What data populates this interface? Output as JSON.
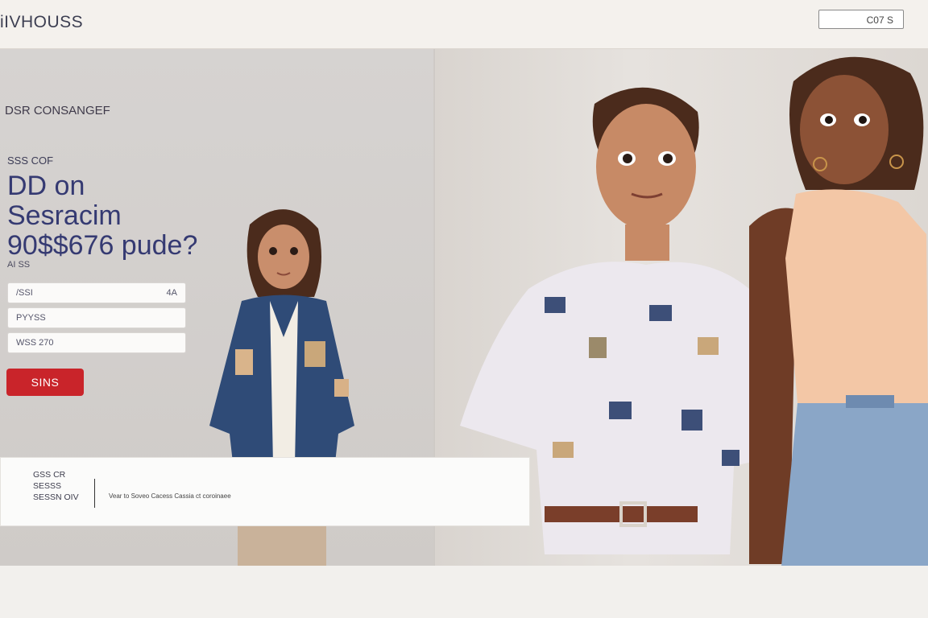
{
  "header": {
    "logo": "iIVHOUSS",
    "top_field_value": "C07 S"
  },
  "hero": {
    "subhead": "DSR CONSANGEF",
    "eyebrow": "SSS COF",
    "headline": [
      "DD on",
      "Sesracim",
      "90$$676 pude?"
    ],
    "caption": "AI SS"
  },
  "form": {
    "fields": [
      {
        "value": "/SSI",
        "suffix": "4A"
      },
      {
        "value": "PYYSS"
      },
      {
        "value": "WSS 270"
      }
    ],
    "submit_label": "SINS"
  },
  "info_card": {
    "lines": [
      "GSS CR",
      "SESSS",
      "SESSN OIV"
    ],
    "text": "Vear to Soveo Cacess Cassia ct coroinaee"
  },
  "colors": {
    "accent": "#c9242a",
    "headline": "#353a72"
  }
}
